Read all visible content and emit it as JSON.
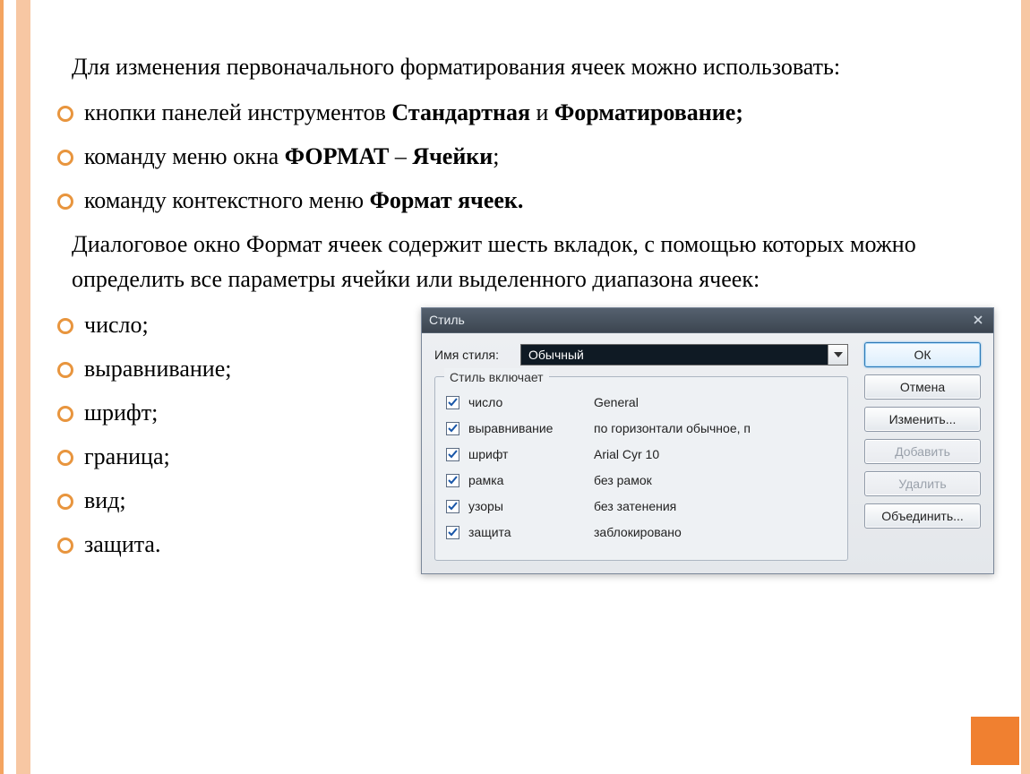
{
  "intro": "Для изменения первоначального форматирования ячеек можно использовать:",
  "bullets_top": [
    {
      "pre": "кнопки панелей инструментов ",
      "b1": "Стандартная",
      "mid": " и ",
      "b2": "Форматирование;"
    },
    {
      "pre": "команду меню окна ",
      "b1": "ФОРМАТ",
      "mid": " – ",
      "b2": "Ячейки",
      "post": ";"
    },
    {
      "pre": "команду контекстного меню ",
      "b1": "Формат ячеек."
    }
  ],
  "outro": "Диалоговое окно Формат ячеек содержит шесть вкладок, с помощью которых можно определить все параметры ячейки или выделенного диапазона ячеек:",
  "bullets_bottom": [
    "число;",
    "выравнивание;",
    "шрифт;",
    "граница;",
    "вид;",
    "защита."
  ],
  "dialog": {
    "title": "Стиль",
    "style_name_label": "Имя стиля:",
    "style_name_value": "Обычный",
    "group_title": "Стиль включает",
    "options": [
      {
        "name": "число",
        "value": "General",
        "checked": true
      },
      {
        "name": "выравнивание",
        "value": "по горизонтали обычное, п",
        "checked": true
      },
      {
        "name": "шрифт",
        "value": "Arial Cyr 10",
        "checked": true
      },
      {
        "name": "рамка",
        "value": "без рамок",
        "checked": true
      },
      {
        "name": "узоры",
        "value": "без затенения",
        "checked": true
      },
      {
        "name": "защита",
        "value": "заблокировано",
        "checked": true
      }
    ],
    "buttons": {
      "ok": "ОК",
      "cancel": "Отмена",
      "modify": "Изменить...",
      "add": "Добавить",
      "delete": "Удалить",
      "merge": "Объединить..."
    }
  }
}
